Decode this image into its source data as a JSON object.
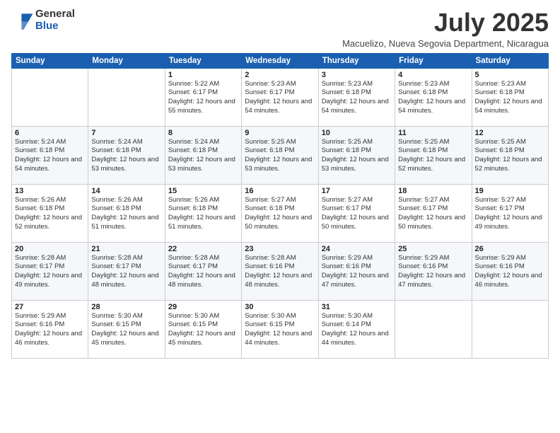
{
  "logo": {
    "general": "General",
    "blue": "Blue"
  },
  "header": {
    "month": "July 2025",
    "location": "Macuelizo, Nueva Segovia Department, Nicaragua"
  },
  "weekdays": [
    "Sunday",
    "Monday",
    "Tuesday",
    "Wednesday",
    "Thursday",
    "Friday",
    "Saturday"
  ],
  "weeks": [
    [
      {
        "day": "",
        "sunrise": "",
        "sunset": "",
        "daylight": ""
      },
      {
        "day": "",
        "sunrise": "",
        "sunset": "",
        "daylight": ""
      },
      {
        "day": "1",
        "sunrise": "Sunrise: 5:22 AM",
        "sunset": "Sunset: 6:17 PM",
        "daylight": "Daylight: 12 hours and 55 minutes."
      },
      {
        "day": "2",
        "sunrise": "Sunrise: 5:23 AM",
        "sunset": "Sunset: 6:17 PM",
        "daylight": "Daylight: 12 hours and 54 minutes."
      },
      {
        "day": "3",
        "sunrise": "Sunrise: 5:23 AM",
        "sunset": "Sunset: 6:18 PM",
        "daylight": "Daylight: 12 hours and 54 minutes."
      },
      {
        "day": "4",
        "sunrise": "Sunrise: 5:23 AM",
        "sunset": "Sunset: 6:18 PM",
        "daylight": "Daylight: 12 hours and 54 minutes."
      },
      {
        "day": "5",
        "sunrise": "Sunrise: 5:23 AM",
        "sunset": "Sunset: 6:18 PM",
        "daylight": "Daylight: 12 hours and 54 minutes."
      }
    ],
    [
      {
        "day": "6",
        "sunrise": "Sunrise: 5:24 AM",
        "sunset": "Sunset: 6:18 PM",
        "daylight": "Daylight: 12 hours and 54 minutes."
      },
      {
        "day": "7",
        "sunrise": "Sunrise: 5:24 AM",
        "sunset": "Sunset: 6:18 PM",
        "daylight": "Daylight: 12 hours and 53 minutes."
      },
      {
        "day": "8",
        "sunrise": "Sunrise: 5:24 AM",
        "sunset": "Sunset: 6:18 PM",
        "daylight": "Daylight: 12 hours and 53 minutes."
      },
      {
        "day": "9",
        "sunrise": "Sunrise: 5:25 AM",
        "sunset": "Sunset: 6:18 PM",
        "daylight": "Daylight: 12 hours and 53 minutes."
      },
      {
        "day": "10",
        "sunrise": "Sunrise: 5:25 AM",
        "sunset": "Sunset: 6:18 PM",
        "daylight": "Daylight: 12 hours and 53 minutes."
      },
      {
        "day": "11",
        "sunrise": "Sunrise: 5:25 AM",
        "sunset": "Sunset: 6:18 PM",
        "daylight": "Daylight: 12 hours and 52 minutes."
      },
      {
        "day": "12",
        "sunrise": "Sunrise: 5:25 AM",
        "sunset": "Sunset: 6:18 PM",
        "daylight": "Daylight: 12 hours and 52 minutes."
      }
    ],
    [
      {
        "day": "13",
        "sunrise": "Sunrise: 5:26 AM",
        "sunset": "Sunset: 6:18 PM",
        "daylight": "Daylight: 12 hours and 52 minutes."
      },
      {
        "day": "14",
        "sunrise": "Sunrise: 5:26 AM",
        "sunset": "Sunset: 6:18 PM",
        "daylight": "Daylight: 12 hours and 51 minutes."
      },
      {
        "day": "15",
        "sunrise": "Sunrise: 5:26 AM",
        "sunset": "Sunset: 6:18 PM",
        "daylight": "Daylight: 12 hours and 51 minutes."
      },
      {
        "day": "16",
        "sunrise": "Sunrise: 5:27 AM",
        "sunset": "Sunset: 6:18 PM",
        "daylight": "Daylight: 12 hours and 50 minutes."
      },
      {
        "day": "17",
        "sunrise": "Sunrise: 5:27 AM",
        "sunset": "Sunset: 6:17 PM",
        "daylight": "Daylight: 12 hours and 50 minutes."
      },
      {
        "day": "18",
        "sunrise": "Sunrise: 5:27 AM",
        "sunset": "Sunset: 6:17 PM",
        "daylight": "Daylight: 12 hours and 50 minutes."
      },
      {
        "day": "19",
        "sunrise": "Sunrise: 5:27 AM",
        "sunset": "Sunset: 6:17 PM",
        "daylight": "Daylight: 12 hours and 49 minutes."
      }
    ],
    [
      {
        "day": "20",
        "sunrise": "Sunrise: 5:28 AM",
        "sunset": "Sunset: 6:17 PM",
        "daylight": "Daylight: 12 hours and 49 minutes."
      },
      {
        "day": "21",
        "sunrise": "Sunrise: 5:28 AM",
        "sunset": "Sunset: 6:17 PM",
        "daylight": "Daylight: 12 hours and 48 minutes."
      },
      {
        "day": "22",
        "sunrise": "Sunrise: 5:28 AM",
        "sunset": "Sunset: 6:17 PM",
        "daylight": "Daylight: 12 hours and 48 minutes."
      },
      {
        "day": "23",
        "sunrise": "Sunrise: 5:28 AM",
        "sunset": "Sunset: 6:16 PM",
        "daylight": "Daylight: 12 hours and 48 minutes."
      },
      {
        "day": "24",
        "sunrise": "Sunrise: 5:29 AM",
        "sunset": "Sunset: 6:16 PM",
        "daylight": "Daylight: 12 hours and 47 minutes."
      },
      {
        "day": "25",
        "sunrise": "Sunrise: 5:29 AM",
        "sunset": "Sunset: 6:16 PM",
        "daylight": "Daylight: 12 hours and 47 minutes."
      },
      {
        "day": "26",
        "sunrise": "Sunrise: 5:29 AM",
        "sunset": "Sunset: 6:16 PM",
        "daylight": "Daylight: 12 hours and 46 minutes."
      }
    ],
    [
      {
        "day": "27",
        "sunrise": "Sunrise: 5:29 AM",
        "sunset": "Sunset: 6:16 PM",
        "daylight": "Daylight: 12 hours and 46 minutes."
      },
      {
        "day": "28",
        "sunrise": "Sunrise: 5:30 AM",
        "sunset": "Sunset: 6:15 PM",
        "daylight": "Daylight: 12 hours and 45 minutes."
      },
      {
        "day": "29",
        "sunrise": "Sunrise: 5:30 AM",
        "sunset": "Sunset: 6:15 PM",
        "daylight": "Daylight: 12 hours and 45 minutes."
      },
      {
        "day": "30",
        "sunrise": "Sunrise: 5:30 AM",
        "sunset": "Sunset: 6:15 PM",
        "daylight": "Daylight: 12 hours and 44 minutes."
      },
      {
        "day": "31",
        "sunrise": "Sunrise: 5:30 AM",
        "sunset": "Sunset: 6:14 PM",
        "daylight": "Daylight: 12 hours and 44 minutes."
      },
      {
        "day": "",
        "sunrise": "",
        "sunset": "",
        "daylight": ""
      },
      {
        "day": "",
        "sunrise": "",
        "sunset": "",
        "daylight": ""
      }
    ]
  ]
}
